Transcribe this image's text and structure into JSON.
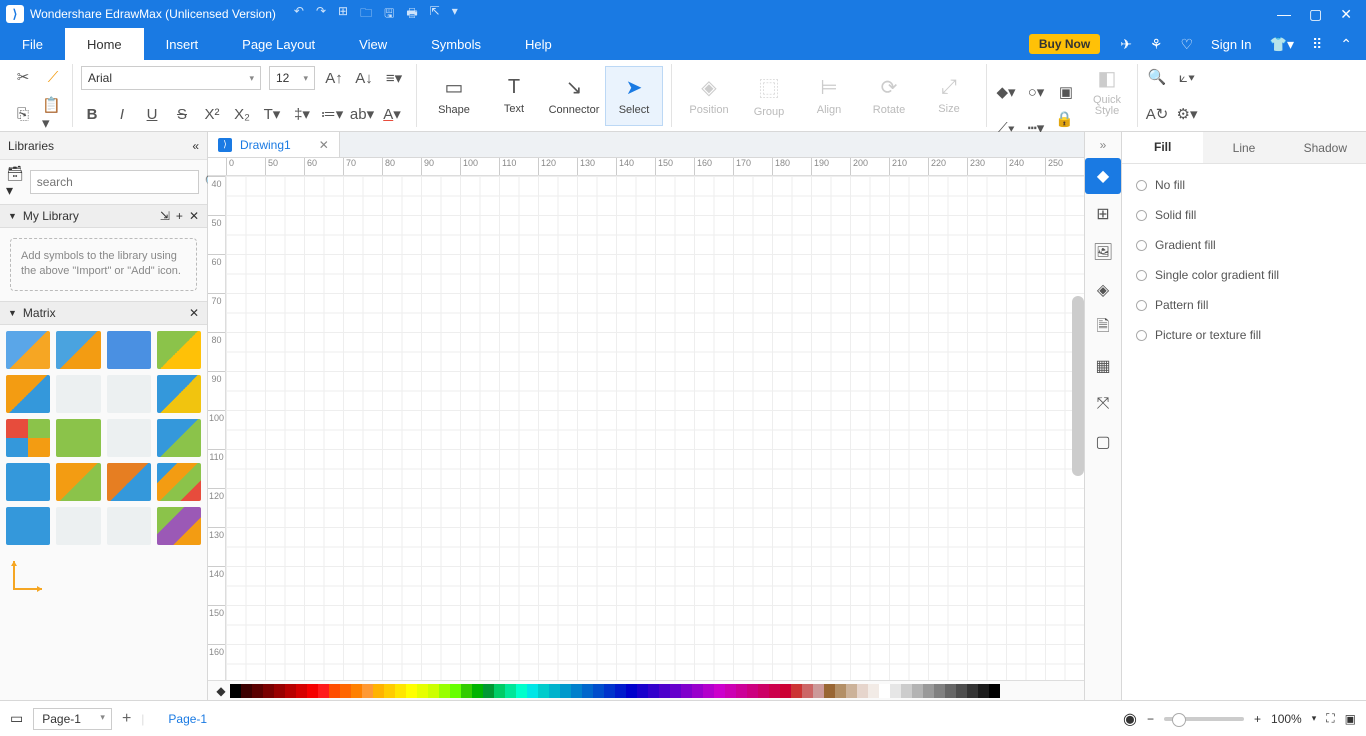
{
  "titlebar": {
    "app_title": "Wondershare EdrawMax (Unlicensed Version)"
  },
  "menubar": {
    "tabs": [
      "File",
      "Home",
      "Insert",
      "Page Layout",
      "View",
      "Symbols",
      "Help"
    ],
    "active_index": 1,
    "buy_label": "Buy Now",
    "signin_label": "Sign In"
  },
  "ribbon": {
    "font_name": "Arial",
    "font_size": "12",
    "big_buttons": {
      "shape": "Shape",
      "text": "Text",
      "connector": "Connector",
      "select": "Select",
      "position": "Position",
      "group": "Group",
      "align": "Align",
      "rotate": "Rotate",
      "size": "Size",
      "quickstyle": "Quick Style"
    }
  },
  "left_panel": {
    "title": "Libraries",
    "search_placeholder": "search",
    "mylib_label": "My Library",
    "mylib_hint": "Add symbols to the library using the above \"Import\" or \"Add\" icon.",
    "matrix_label": "Matrix"
  },
  "document": {
    "tab_name": "Drawing1",
    "ruler_h": [
      "0",
      "50",
      "60",
      "70",
      "80",
      "90",
      "100",
      "110",
      "120",
      "130",
      "140",
      "150",
      "160",
      "170",
      "180",
      "190",
      "200",
      "210",
      "220",
      "230",
      "240",
      "250"
    ],
    "ruler_v": [
      "40",
      "50",
      "60",
      "70",
      "80",
      "90",
      "100",
      "110",
      "120",
      "130",
      "140",
      "150",
      "160"
    ]
  },
  "right_panel": {
    "tabs": [
      "Fill",
      "Line",
      "Shadow"
    ],
    "active_index": 0,
    "fill_options": [
      "No fill",
      "Solid fill",
      "Gradient fill",
      "Single color gradient fill",
      "Pattern fill",
      "Picture or texture fill"
    ]
  },
  "statusbar": {
    "page_selector": "Page-1",
    "page_tab": "Page-1",
    "zoom": "100%"
  },
  "color_swatches": [
    "#000000",
    "#3b0000",
    "#5a0000",
    "#7a0000",
    "#990000",
    "#b80000",
    "#d60000",
    "#f50000",
    "#ff1a1a",
    "#ff4d00",
    "#ff6600",
    "#ff8000",
    "#ff9933",
    "#ffb300",
    "#ffcc00",
    "#ffe600",
    "#ffff00",
    "#e6ff00",
    "#ccff00",
    "#99ff00",
    "#66ff00",
    "#33cc00",
    "#00b300",
    "#009933",
    "#00cc66",
    "#00e699",
    "#00ffcc",
    "#00e6e6",
    "#00cccc",
    "#00b3cc",
    "#0099cc",
    "#0080cc",
    "#0066cc",
    "#004dcc",
    "#0033cc",
    "#001acc",
    "#0000cc",
    "#1a00cc",
    "#3300cc",
    "#4d00cc",
    "#6600cc",
    "#8000cc",
    "#9900cc",
    "#b300cc",
    "#cc00cc",
    "#cc00b3",
    "#cc0099",
    "#cc0080",
    "#cc0066",
    "#cc004d",
    "#cc0033",
    "#cc3333",
    "#cc6666",
    "#cc9999",
    "#996633",
    "#b38f66",
    "#ccb299",
    "#e6d5cc",
    "#f2ebe6",
    "#ffffff",
    "#e6e6e6",
    "#cccccc",
    "#b3b3b3",
    "#999999",
    "#808080",
    "#666666",
    "#4d4d4d",
    "#333333",
    "#1a1a1a",
    "#000000"
  ],
  "matrix_colors": [
    "linear-gradient(135deg,#5aa6e8 50%,#f6a623 50%)",
    "linear-gradient(135deg,#4aa3df 50%,#f39c12 50%)",
    "linear-gradient(#4a90e2,#4a90e2)",
    "linear-gradient(135deg,#8bc34a 50%,#ffc107 50%)",
    "linear-gradient(135deg,#f39c12 50%,#3498db 50%)",
    "linear-gradient(#ecf0f1,#ecf0f1)",
    "linear-gradient(#ecf0f1,#ecf0f1)",
    "linear-gradient(135deg,#3498db 50%,#f1c40f 50%)",
    "conic-gradient(#8bc34a 0 90deg,#f39c12 90deg 180deg,#3498db 180deg 270deg,#e74c3c 270deg)",
    "linear-gradient(#8bc34a,#8bc34a)",
    "linear-gradient(#ecf0f1,#ecf0f1)",
    "linear-gradient(135deg,#3498db 50%,#8bc34a 50%)",
    "linear-gradient(#3498db,#3498db)",
    "linear-gradient(135deg,#f39c12 50%,#8bc34a 50%)",
    "linear-gradient(135deg,#e67e22 50%,#3498db 50%)",
    "linear-gradient(135deg,#3498db 25%,#f39c12 25% 50%,#8bc34a 50% 75%,#e74c3c 75%)",
    "linear-gradient(#3498db,#3498db)",
    "linear-gradient(#ecf0f1,#ecf0f1)",
    "linear-gradient(#ecf0f1,#ecf0f1)",
    "linear-gradient(135deg,#8bc34a 33%,#9b59b6 33% 66%,#f39c12 66%)"
  ]
}
